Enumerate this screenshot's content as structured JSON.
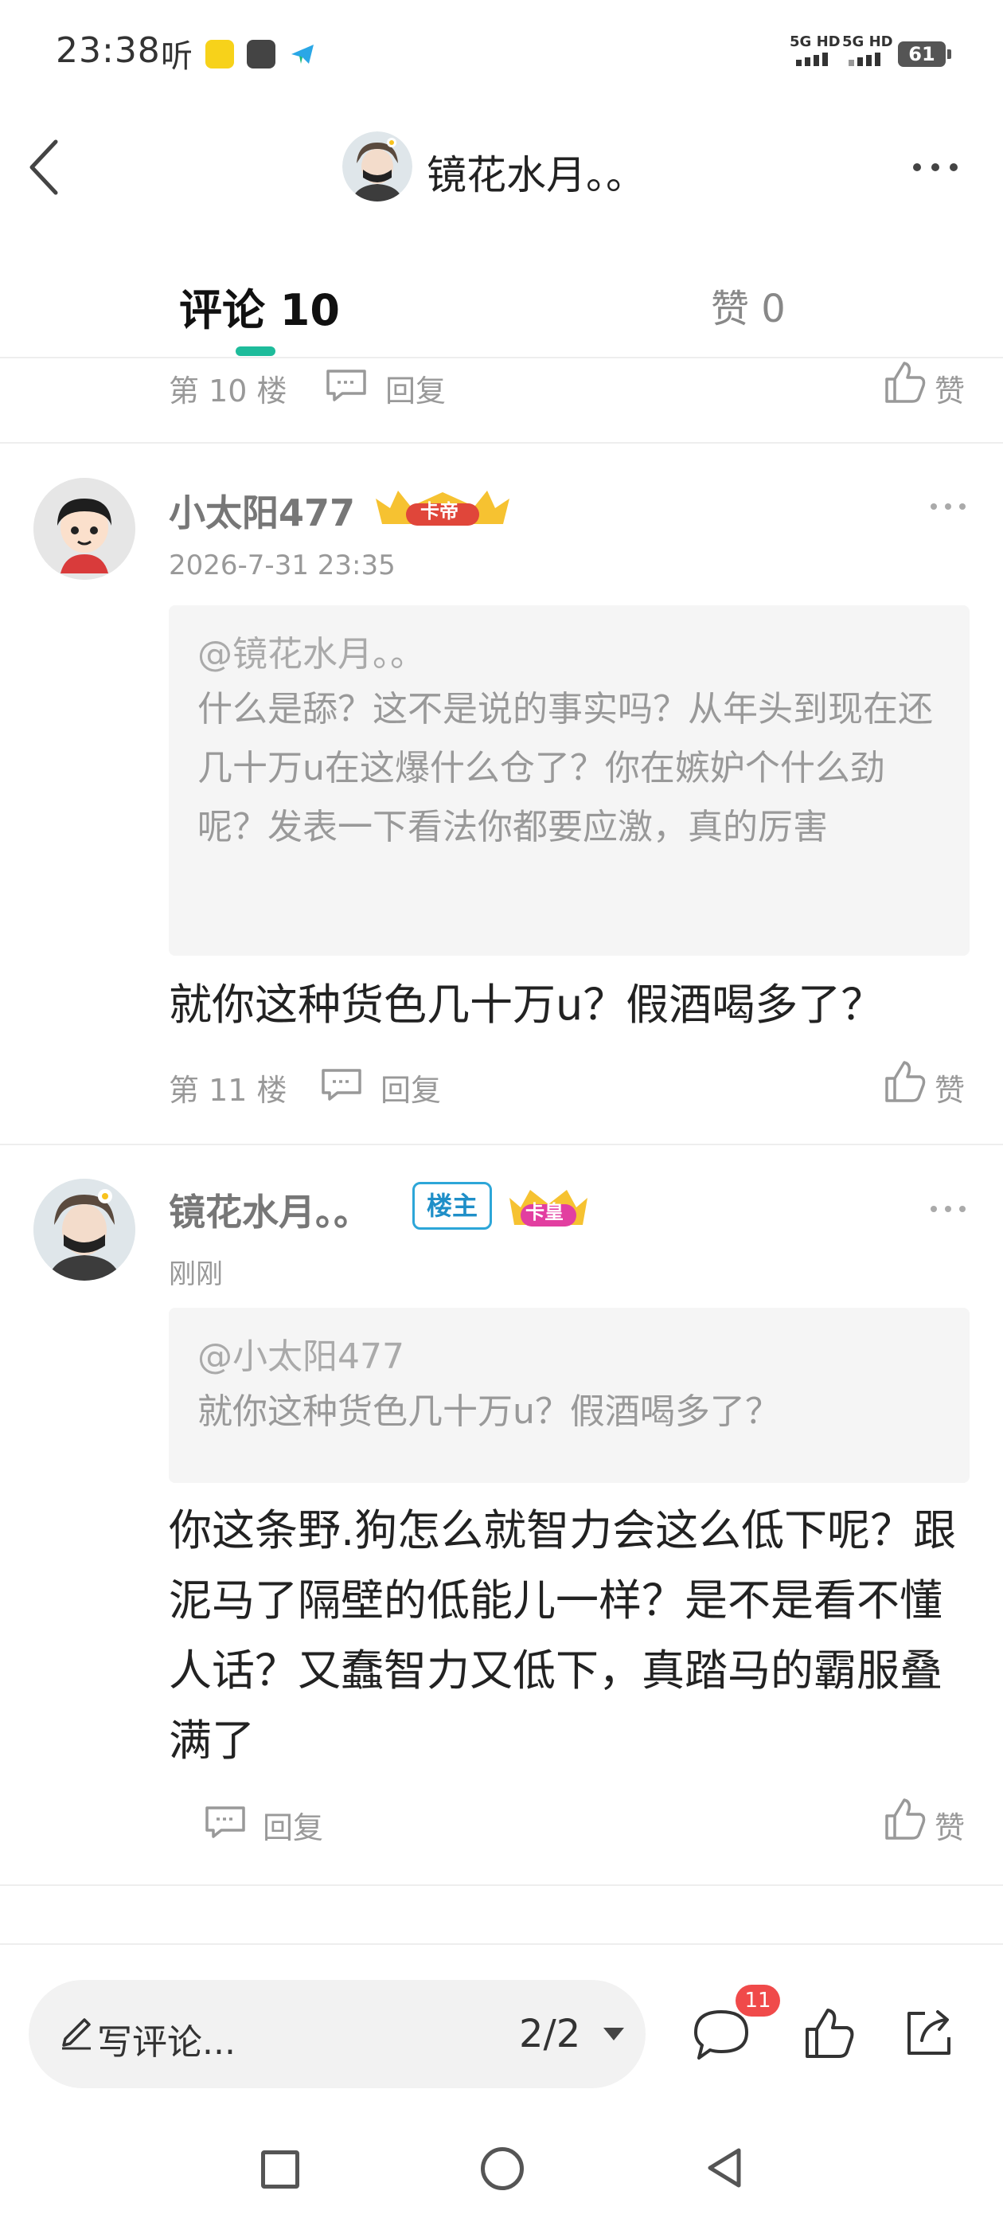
{
  "status_bar": {
    "time": "23:38",
    "extra": "听",
    "network_1": "5G HD",
    "network_2": "5G HD",
    "battery": "61"
  },
  "header": {
    "title": "镜花水月。。"
  },
  "tabs": {
    "comments_label": "评论 10",
    "likes_label": "赞 0",
    "active_color": "#1ebc9b"
  },
  "actions": {
    "reply_label": "回复",
    "like_label": "赞"
  },
  "comments": [
    {
      "floor": "第 10 楼"
    },
    {
      "user": "小太阳477",
      "badge": "卡帝",
      "time": "2026-7-31 23:35",
      "quote_mention": "@镜花水月。。",
      "quote_text": "什么是舔？这不是说的事实吗？从年头到现在还几十万u在这爆什么仓了？你在嫉妒个什么劲呢？发表一下看法你都要应激，真的厉害",
      "body": "就你这种货色几十万u？假酒喝多了？",
      "floor": "第 11 楼"
    },
    {
      "user": "镜花水月。。",
      "op_badge": "楼主",
      "badge": "卡皇",
      "time": "刚刚",
      "quote_mention": "@小太阳477",
      "quote_text": "就你这种货色几十万u？假酒喝多了？",
      "body": "你这条野.狗怎么就智力会这么低下呢？跟泥马了隔壁的低能儿一样？是不是看不懂人话？又蠢智力又低下，真踏马的霸服叠满了"
    }
  ],
  "bottom_bar": {
    "write_placeholder": "写评论...",
    "page": "2/2",
    "comment_count": "11"
  },
  "icons": {
    "back": "chevron-left-icon",
    "more": "more-dots-icon",
    "reply": "reply-bubble-icon",
    "like": "thumbs-up-icon",
    "share": "share-icon",
    "pen": "pen-icon"
  }
}
